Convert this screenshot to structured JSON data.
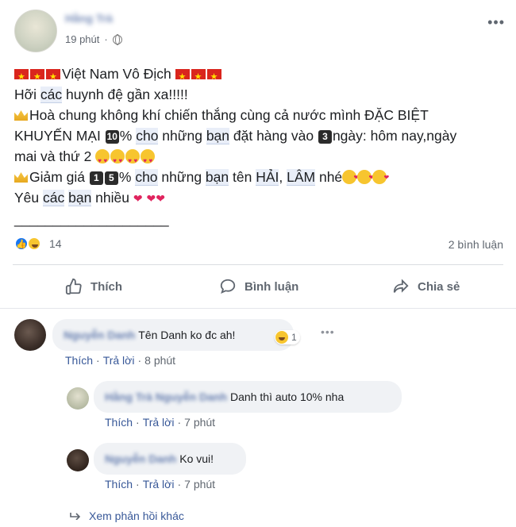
{
  "post": {
    "author": "Hằng Trà",
    "time": "19 phút",
    "more_icon": "more-dots-icon",
    "lines": {
      "l1_text": "Việt Nam Vô Địch",
      "l2_a": "Hỡi ",
      "l2_b": "các",
      "l2_c": " huynh đệ gần xa!!!!!",
      "l3": "Hoà chung không khí chiến thắng cùng cả nước mình ĐẶC BIỆT",
      "l4_a": "KHUYẾN MẠI ",
      "l4_kbd": "10",
      "l4_b": "% ",
      "l4_c": "cho",
      "l4_d": " những ",
      "l4_e": "bạn",
      "l4_f": " đặt hàng vào ",
      "l4_kbd2": "3",
      "l4_g": "ngày: hôm nay,ngày",
      "l5": "mai và thứ 2",
      "l6_a": "Giảm giá ",
      "l6_kbd1": "1",
      "l6_kbd2": "5",
      "l6_b": "% ",
      "l6_c": "cho",
      "l6_d": " những ",
      "l6_e": "bạn",
      "l6_f": " tên ",
      "l6_g": "HẢI",
      "l6_h": ", ",
      "l6_i": "LÂM",
      "l6_j": " nhé",
      "l7_a": "Yêu ",
      "l7_b": "các",
      "l7_c": " ",
      "l7_d": "bạn",
      "l7_e": " nhiều",
      "l8": "____________________"
    },
    "reactions_count": "14",
    "comments_count": "2 bình luận"
  },
  "actions": {
    "like": "Thích",
    "comment": "Bình luận",
    "share": "Chia sẻ"
  },
  "comments": [
    {
      "name": "Nguyễn Danh",
      "text": "Tên Danh ko đc ah!",
      "reaction_count": "1",
      "like": "Thích",
      "reply": "Trả lời",
      "time": "8 phút"
    },
    {
      "name": "Hằng Trà Nguyễn Danh",
      "text": "Danh thì auto 10% nha",
      "like": "Thích",
      "reply": "Trả lời",
      "time": "7 phút"
    },
    {
      "name": "Nguyễn Danh",
      "text": "Ko vui!",
      "like": "Thích",
      "reply": "Trả lời",
      "time": "7 phút"
    }
  ],
  "more_replies": "Xem phản hồi khác",
  "colors": {
    "link": "#385898",
    "like_blue": "#1877f2",
    "muted": "#606770",
    "bubble": "#f0f2f5"
  }
}
